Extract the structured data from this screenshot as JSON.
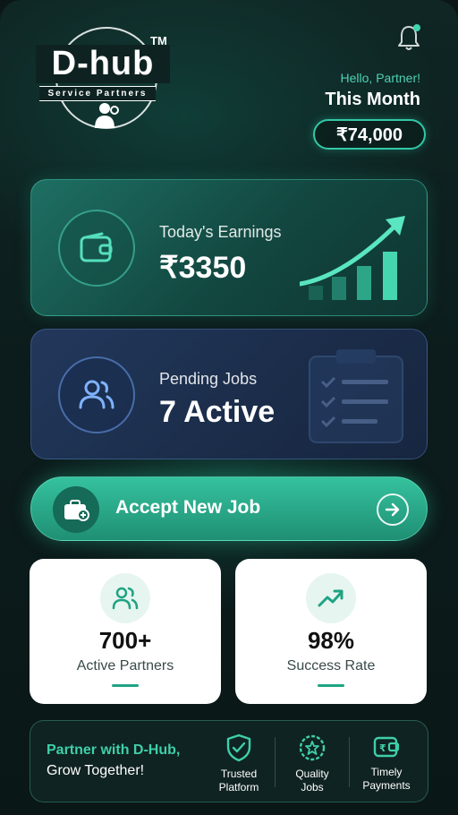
{
  "brand": {
    "name": "D-hub",
    "tm": "TM",
    "tagline": "Service Partners"
  },
  "header": {
    "greeting": "Hello, Partner!",
    "period_label": "This Month",
    "period_amount": "₹74,000"
  },
  "earnings_card": {
    "label": "Today's Earnings",
    "value": "₹3350",
    "icon": "wallet-icon"
  },
  "jobs_card": {
    "label": "Pending Jobs",
    "value": "7 Active",
    "icon": "users-icon"
  },
  "accept_button": {
    "label": "Accept New Job",
    "icon": "briefcase-plus-icon",
    "arrow_icon": "arrow-right-icon"
  },
  "stats": [
    {
      "value": "700+",
      "label": "Active Partners",
      "icon": "users-icon"
    },
    {
      "value": "98%",
      "label": "Success Rate",
      "icon": "trend-up-icon"
    }
  ],
  "footer": {
    "title": "Partner with D-Hub,",
    "subtitle": "Grow Together!",
    "features": [
      {
        "line1": "Trusted",
        "line2": "Platform",
        "icon": "shield-check-icon"
      },
      {
        "line1": "Quality",
        "line2": "Jobs",
        "icon": "star-badge-icon"
      },
      {
        "line1": "Timely",
        "line2": "Payments",
        "icon": "rupee-wallet-icon"
      }
    ]
  },
  "colors": {
    "accent": "#32c9a6",
    "background": "#0c1c1c",
    "earnings_card": "#1e6f63",
    "jobs_card": "#1b2d4a",
    "notification_dot": "#3fd6b0"
  }
}
